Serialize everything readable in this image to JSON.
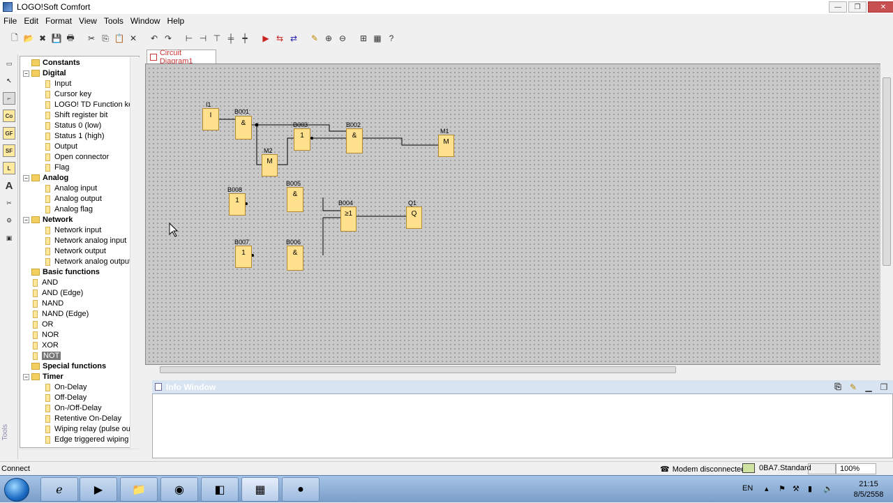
{
  "window": {
    "title": "LOGO!Soft Comfort",
    "min": "—",
    "max": "❐",
    "close": "✕"
  },
  "menu": [
    "File",
    "Edit",
    "Format",
    "View",
    "Tools",
    "Window",
    "Help"
  ],
  "toolbar": [
    "new-icon",
    "open-icon",
    "close-file-icon",
    "save-icon",
    "print-icon",
    "cut-icon",
    "copy-icon",
    "paste-icon",
    "delete-icon",
    "undo-icon",
    "redo-icon",
    "align-left-icon",
    "align-right-icon",
    "align-top-icon",
    "align-vcenter-icon",
    "align-hcenter-icon",
    "simulation-icon",
    "transfer-pc-icon",
    "transfer-logo-icon",
    "wizard-icon",
    "zoom-in-icon",
    "zoom-out-icon",
    "fit-icon",
    "grid-icon",
    "help-icon"
  ],
  "left_tools": [
    "Co",
    "GF",
    "SF",
    "L",
    "A"
  ],
  "left_tools_label": "Tools",
  "tree": {
    "constants": "Constants",
    "digital": "Digital",
    "digital_items": [
      "Input",
      "Cursor key",
      "LOGO! TD Function key",
      "Shift register bit",
      "Status 0 (low)",
      "Status 1 (high)",
      "Output",
      "Open connector",
      "Flag"
    ],
    "digital_badges": [
      "I",
      "C",
      "F",
      "S",
      "lo",
      "hi",
      "Q",
      "X",
      "M"
    ],
    "analog": "Analog",
    "analog_items": [
      "Analog input",
      "Analog output",
      "Analog flag"
    ],
    "analog_badges": [
      "AI",
      "AQ",
      "AM"
    ],
    "network": "Network",
    "network_items": [
      "Network input",
      "Network analog input",
      "Network output",
      "Network analog output"
    ],
    "network_badges": [
      "I",
      "AI",
      "Q",
      "AQ"
    ],
    "basic": "Basic functions",
    "basic_items": [
      "AND",
      "AND (Edge)",
      "NAND",
      "NAND (Edge)",
      "OR",
      "NOR",
      "XOR",
      "NOT"
    ],
    "special": "Special functions",
    "timer": "Timer",
    "timer_items": [
      "On-Delay",
      "Off-Delay",
      "On-/Off-Delay",
      "Retentive On-Delay",
      "Wiping relay (pulse outp",
      "Edge triggered wiping re"
    ]
  },
  "tab": {
    "label": "Circuit Diagram1"
  },
  "diagram": {
    "blocks": [
      {
        "id": "I1",
        "symbol": "I"
      },
      {
        "id": "B001",
        "symbol": "&"
      },
      {
        "id": "M2",
        "symbol": "M"
      },
      {
        "id": "B003",
        "symbol": "1"
      },
      {
        "id": "B002",
        "symbol": "&"
      },
      {
        "id": "M1",
        "symbol": "M"
      },
      {
        "id": "B008",
        "symbol": "1"
      },
      {
        "id": "B005",
        "symbol": "&"
      },
      {
        "id": "B004",
        "symbol": "≥1"
      },
      {
        "id": "Q1",
        "symbol": "Q"
      },
      {
        "id": "B007",
        "symbol": "1"
      },
      {
        "id": "B006",
        "symbol": "&"
      }
    ]
  },
  "info": {
    "title": "Info Window"
  },
  "status": {
    "left": "Connect",
    "modem": "Modem disconnected",
    "device": "0BA7.Standard",
    "zoom": "100%"
  },
  "taskbar": {
    "lang": "EN",
    "time": "21:15",
    "date": "8/5/2558"
  }
}
